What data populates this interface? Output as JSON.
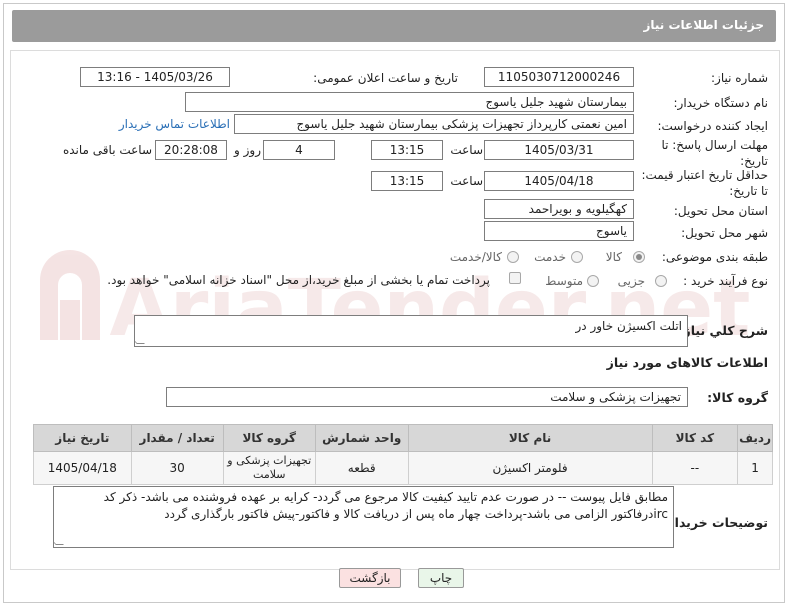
{
  "header": {
    "title": "جزئیات اطلاعات نیاز"
  },
  "labels": {
    "need_number": "شماره نیاز:",
    "announce_datetime": "تاریخ و ساعت اعلان عمومی:",
    "buyer_org": "نام دستگاه خریدار:",
    "requester": "ایجاد کننده درخواست:",
    "reply_deadline": "مهلت ارسال پاسخ: تا تاریخ:",
    "time": "ساعت",
    "days_and": "روز و",
    "remaining": "ساعت باقی مانده",
    "price_validity": "حداقل تاریخ اعتبار قیمت: تا تاریخ:",
    "province": "استان محل تحویل:",
    "city": "شهر محل تحویل:",
    "category": "طبقه بندی موضوعی:",
    "process_type": "نوع فرآیند خرید :",
    "need_desc": "شرح کلي نياز:",
    "goods_info": "اطلاعات کالاهای مورد نیاز",
    "goods_group": "گروه کالا:",
    "buyer_notes": "توضیحات خریدار:"
  },
  "values": {
    "need_number": "1105030712000246",
    "announce_datetime": "1405/03/26 - 13:16",
    "buyer_org": "بیمارستان شهید جلیل یاسوج",
    "requester": "امین نعمتی کارپرداز تجهیزات پزشکی بیمارستان شهید جلیل یاسوج",
    "contact_link": "اطلاعات تماس خریدار",
    "reply_date": "1405/03/31",
    "reply_time": "13:15",
    "days": "4",
    "remaining_time": "20:28:08",
    "validity_date": "1405/04/18",
    "validity_time": "13:15",
    "province": "کهگیلویه و بویراحمد",
    "city": "یاسوج",
    "need_desc": "اتلت اکسیژن خاور در",
    "goods_group": "تجهیزات پزشکی و سلامت",
    "buyer_notes": "مطابق فایل پیوست -- در صورت عدم تایید کیفیت کالا مرجوع می گردد- کرایه بر عهده فروشنده می باشد- ذکر کد ircدرفاکتور الزامی می باشد-پرداخت چهار ماه پس از دریافت کالا و فاکتور-پیش فاکتور بارگذاری گردد"
  },
  "category_options": [
    {
      "label": "کالا",
      "selected": true
    },
    {
      "label": "خدمت",
      "selected": false
    },
    {
      "label": "کالا/خدمت",
      "selected": false
    }
  ],
  "process_options": [
    {
      "label": "جزیی",
      "selected": false
    },
    {
      "label": "متوسط",
      "selected": false
    }
  ],
  "payment_note": "پرداخت تمام یا بخشی از مبلغ خرید،از محل \"اسناد خزانه اسلامی\" خواهد بود.",
  "table": {
    "headers": [
      "ردیف",
      "کد کالا",
      "نام کالا",
      "واحد شمارش",
      "گروه کالا",
      "تعداد / مقدار",
      "تاریخ نیاز"
    ],
    "rows": [
      [
        "1",
        "--",
        "فلومتر اکسیژن",
        "قطعه",
        "تجهیزات پزشکی و سلامت",
        "30",
        "1405/04/18"
      ]
    ]
  },
  "buttons": {
    "print": "چاپ",
    "back": "بازگشت"
  },
  "watermark": "AriaTender.net",
  "colors": {
    "header_bg": "#9b9b9b",
    "link": "#2a6fb6",
    "print_btn": "#e9f6e9",
    "back_btn": "#fbe1e1"
  }
}
